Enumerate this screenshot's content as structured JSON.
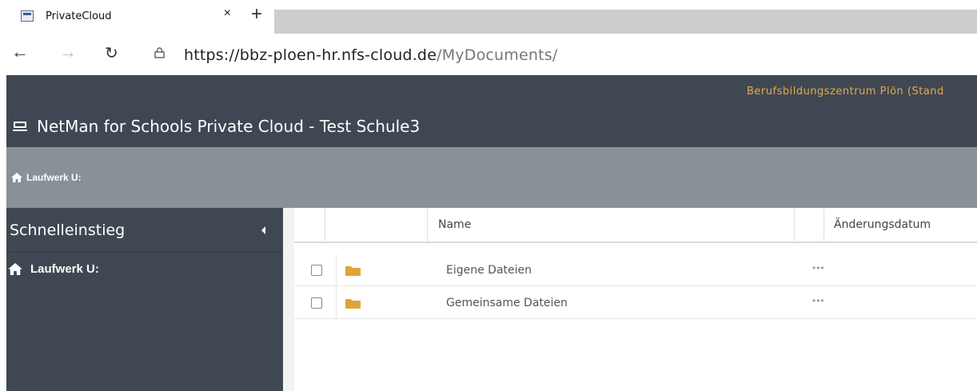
{
  "browser": {
    "tab_title": "PrivateCloud",
    "close_glyph": "×",
    "newtab_glyph": "+",
    "back_glyph": "←",
    "forward_glyph": "→",
    "reload_glyph": "↻",
    "url_host": "https://bbz-ploen-hr.nfs-cloud.de",
    "url_path": "/MyDocuments/"
  },
  "header": {
    "org": "Berufsbildungszentrum Plön (Stand",
    "title": "NetMan for Schools Private Cloud - Test Schule3"
  },
  "breadcrumb": {
    "label": "Laufwerk U:"
  },
  "sidebar": {
    "heading": "Schnelleinstieg",
    "items": [
      {
        "label": "Laufwerk U:"
      }
    ]
  },
  "table": {
    "columns": [
      "Name",
      "Änderungsdatum"
    ],
    "rows": [
      {
        "name": "Eigene Dateien",
        "actions": "•••"
      },
      {
        "name": "Gemeinsame Dateien",
        "actions": "•••"
      }
    ]
  },
  "colors": {
    "header_bg": "#3f4852",
    "breadcrumb_bg": "#889198",
    "org_text": "#e7a84a",
    "folder": "#e0a43c"
  },
  "icons": {
    "favicon": "netman-favicon-icon",
    "lock": "lock-icon",
    "cloud": "cloud-drive-icon",
    "home": "home-icon",
    "folder": "folder-icon",
    "collapse": "caret-left-icon"
  }
}
